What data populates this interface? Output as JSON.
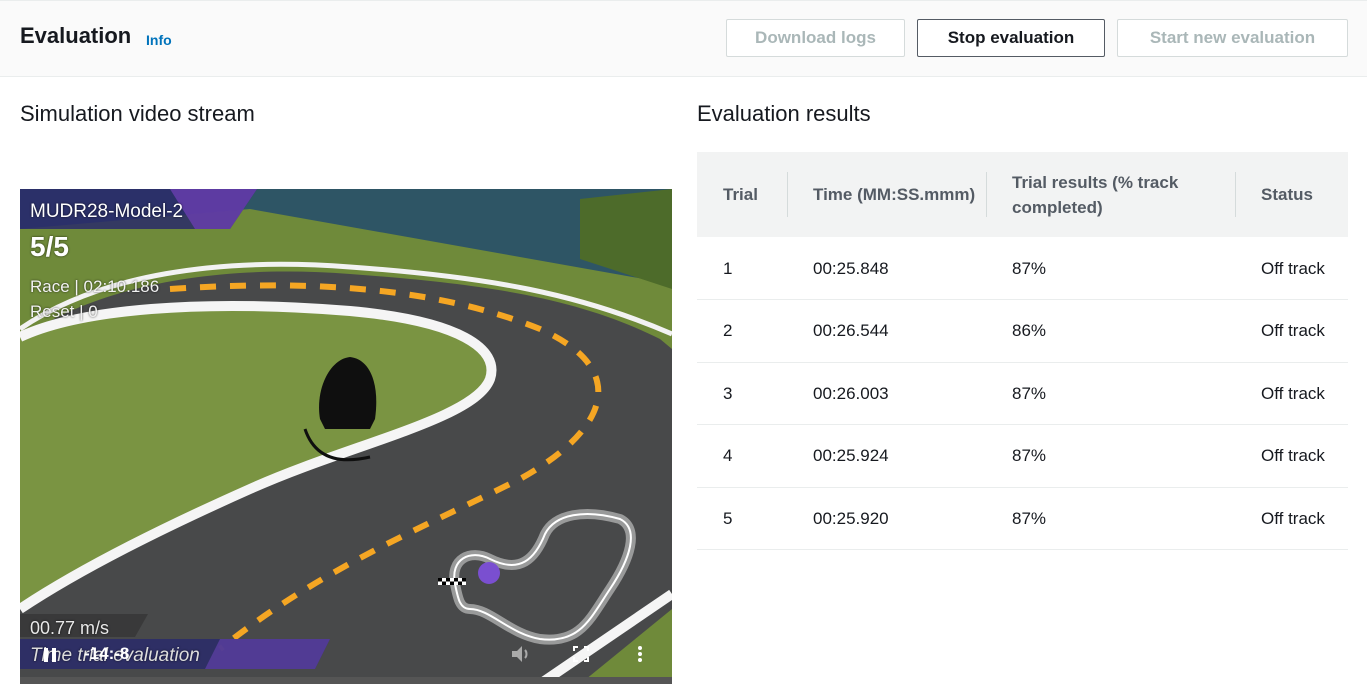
{
  "header": {
    "title": "Evaluation",
    "info_link": "Info",
    "buttons": {
      "download_logs": "Download logs",
      "stop_evaluation": "Stop evaluation",
      "start_new_evaluation": "Start new evaluation"
    }
  },
  "video_section": {
    "title": "Simulation video stream",
    "overlay": {
      "model_name": "MUDR28-Model-2",
      "lap": "5/5",
      "race_time": "Race | 02:10.186",
      "resets": "Reset | 0",
      "speed": "00.77 m/s",
      "caption": "Time trial evaluation",
      "player_time": "-14:-8"
    },
    "controls": {
      "pause": "pause-icon",
      "volume": "volume-icon",
      "fullscreen": "fullscreen-icon",
      "more": "more-vertical-icon"
    }
  },
  "results_section": {
    "title": "Evaluation results",
    "columns": {
      "trial": "Trial",
      "time": "Time (MM:SS.mmm)",
      "trial_results": "Trial results (% track completed)",
      "status": "Status"
    },
    "rows": [
      {
        "trial": "1",
        "time": "00:25.848",
        "completed": "87%",
        "status": "Off track"
      },
      {
        "trial": "2",
        "time": "00:26.544",
        "completed": "86%",
        "status": "Off track"
      },
      {
        "trial": "3",
        "time": "00:26.003",
        "completed": "87%",
        "status": "Off track"
      },
      {
        "trial": "4",
        "time": "00:25.924",
        "completed": "87%",
        "status": "Off track"
      },
      {
        "trial": "5",
        "time": "00:25.920",
        "completed": "87%",
        "status": "Off track"
      }
    ]
  },
  "colors": {
    "link": "#0073bb",
    "header_bg": "#fafafa",
    "table_header_bg": "#f2f3f3",
    "disabled_text": "#aab7b8",
    "track_line": "#f5a623"
  }
}
